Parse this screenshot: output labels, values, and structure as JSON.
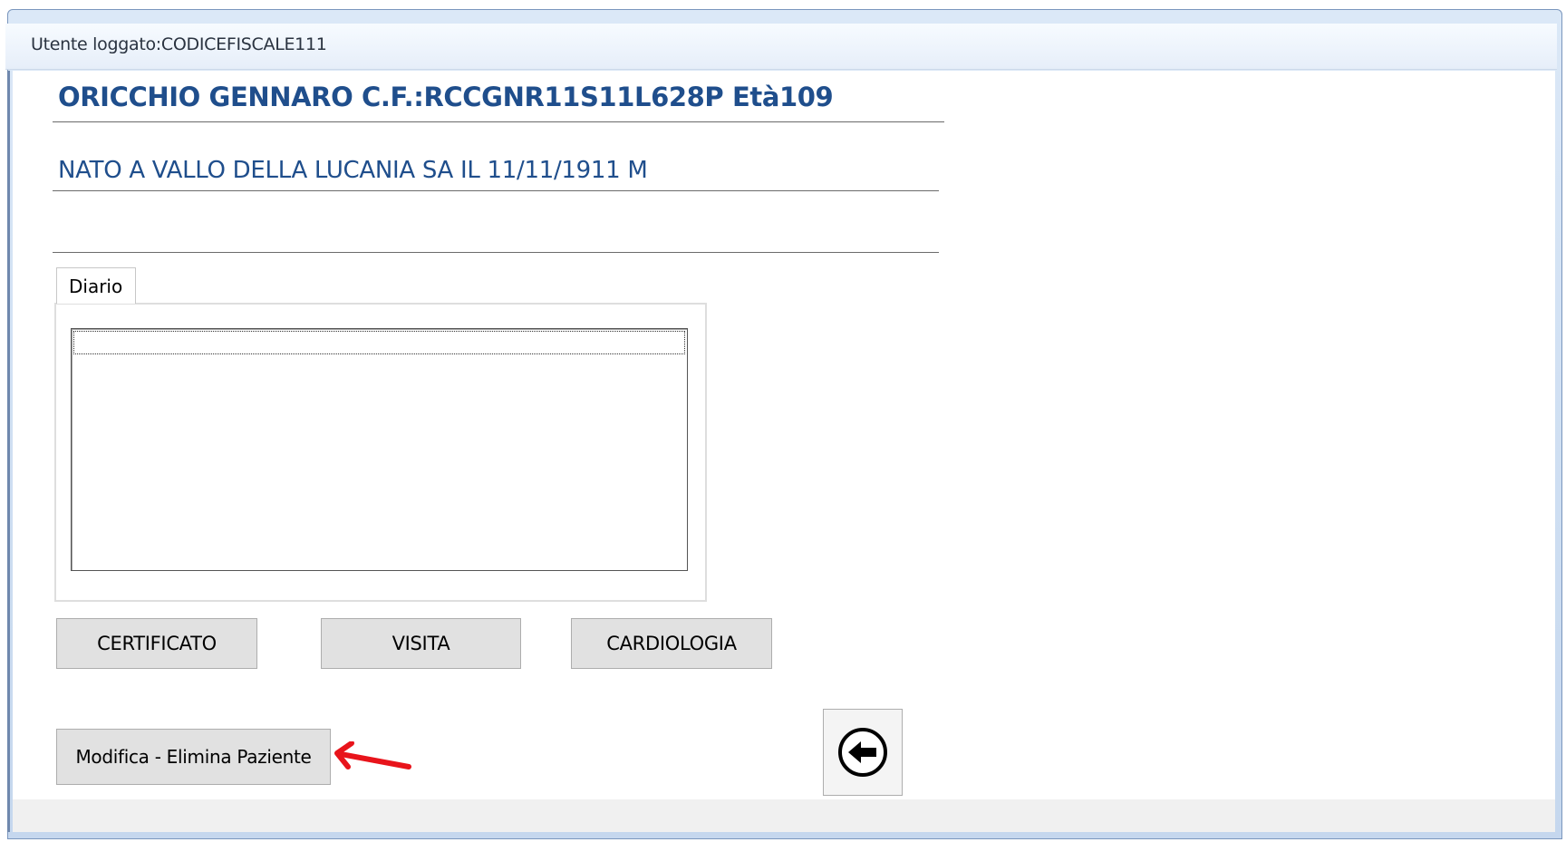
{
  "window": {
    "title": "Utente loggato:CODICEFISCALE111"
  },
  "patient": {
    "title_line": "ORICCHIO GENNARO C.F.:RCCGNR11S11L628P Età109",
    "birth_line": "NATO A VALLO DELLA LUCANIA SA IL 11/11/1911 M"
  },
  "tabs": [
    {
      "label": "Diario",
      "selected": true
    }
  ],
  "buttons": {
    "certificato": "CERTIFICATO",
    "visita": "VISITA",
    "cardiologia": "CARDIOLOGIA",
    "modifica": "Modifica - Elimina Paziente"
  },
  "icons": {
    "back": "back-arrow-icon",
    "annotation": "red-arrow-annotation"
  },
  "colors": {
    "header_text": "#1f4e8c",
    "annotation": "#e8141b",
    "button_face": "#e1e1e1"
  }
}
